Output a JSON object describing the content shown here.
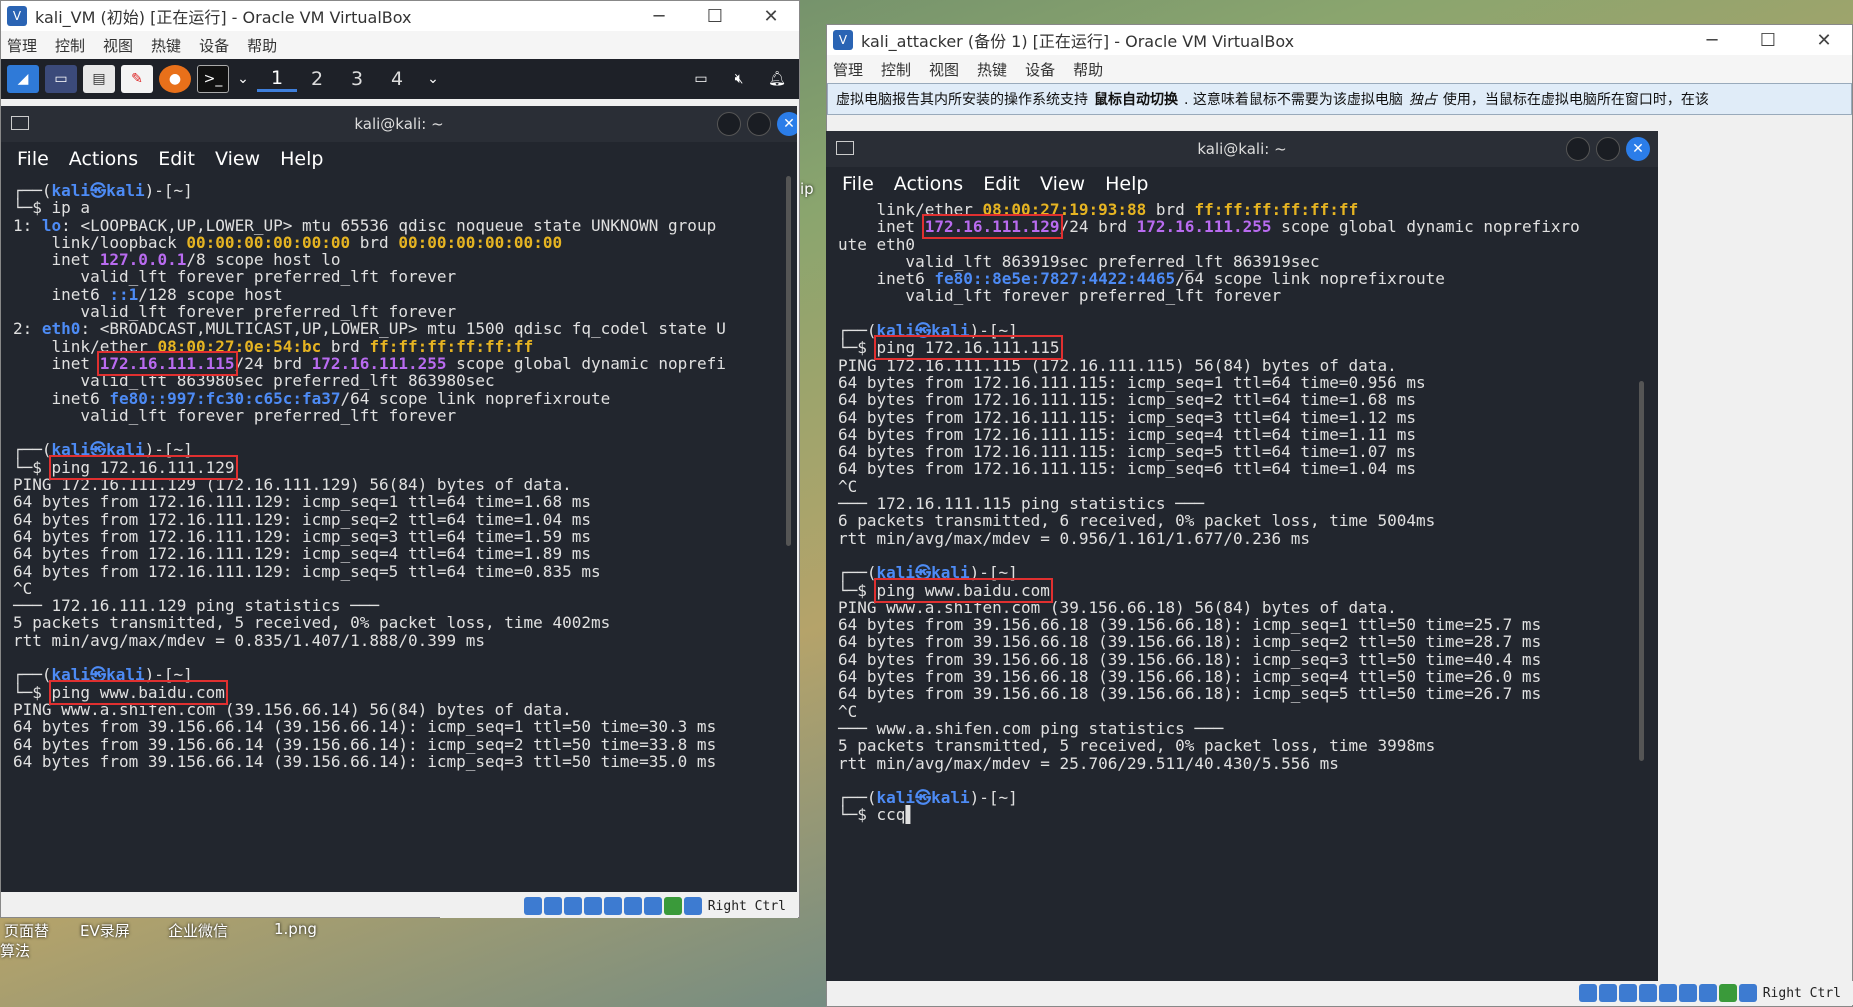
{
  "desktop": {
    "labels": [
      "页面替",
      "EV录屏",
      "企业微信",
      "1.png",
      "算法"
    ],
    "side_label": "ip"
  },
  "left": {
    "title": "kali_VM (初始) [正在运行] - Oracle VM VirtualBox",
    "menu": [
      "管理",
      "控制",
      "视图",
      "热键",
      "设备",
      "帮助"
    ],
    "workspaces": [
      "1",
      "2",
      "3",
      "4"
    ],
    "term_title": "kali@kali: ~",
    "term_menu": [
      "File",
      "Actions",
      "Edit",
      "View",
      "Help"
    ],
    "status": "Right Ctrl",
    "lines": [
      [
        {
          "t": "┌──(",
          "c": ""
        },
        {
          "t": "kali㉿kali",
          "c": "blue"
        },
        {
          "t": ")-[~]",
          "c": ""
        }
      ],
      [
        {
          "t": "└─$ ",
          "c": ""
        },
        {
          "t": "ip a",
          "c": ""
        }
      ],
      [
        {
          "t": "1: ",
          "c": ""
        },
        {
          "t": "lo",
          "c": "blue"
        },
        {
          "t": ": <LOOPBACK,UP,LOWER_UP> mtu 65536 qdisc noqueue state UNKNOWN group",
          "c": ""
        }
      ],
      [
        {
          "t": "    link/loopback ",
          "c": ""
        },
        {
          "t": "00:00:00:00:00:00",
          "c": "yel"
        },
        {
          "t": " brd ",
          "c": ""
        },
        {
          "t": "00:00:00:00:00:00",
          "c": "yel"
        }
      ],
      [
        {
          "t": "    inet ",
          "c": ""
        },
        {
          "t": "127.0.0.1",
          "c": "purp"
        },
        {
          "t": "/8 scope host lo",
          "c": ""
        }
      ],
      [
        {
          "t": "       valid_lft forever preferred_lft forever",
          "c": ""
        }
      ],
      [
        {
          "t": "    inet6 ",
          "c": ""
        },
        {
          "t": "::1",
          "c": "blue"
        },
        {
          "t": "/128 scope host",
          "c": ""
        }
      ],
      [
        {
          "t": "       valid_lft forever preferred_lft forever",
          "c": ""
        }
      ],
      [
        {
          "t": "2: ",
          "c": ""
        },
        {
          "t": "eth0",
          "c": "blue"
        },
        {
          "t": ": <BROADCAST,MULTICAST,UP,LOWER_UP> mtu 1500 qdisc fq_codel state U",
          "c": ""
        }
      ],
      [
        {
          "t": "    link/ether ",
          "c": ""
        },
        {
          "t": "08:00:27:0e:54:bc",
          "c": "yel"
        },
        {
          "t": " brd ",
          "c": ""
        },
        {
          "t": "ff:ff:ff:ff:ff:ff",
          "c": "yel"
        }
      ],
      [
        {
          "t": "    inet ",
          "c": ""
        },
        {
          "t": "172.16.111.115",
          "c": "purp",
          "hl": true
        },
        {
          "t": "/24 brd ",
          "c": ""
        },
        {
          "t": "172.16.111.255",
          "c": "purp"
        },
        {
          "t": " scope global dynamic noprefi",
          "c": ""
        }
      ],
      [
        {
          "t": "       valid_lft 863980sec preferred_lft 863980sec",
          "c": ""
        }
      ],
      [
        {
          "t": "    inet6 ",
          "c": ""
        },
        {
          "t": "fe80::997:fc30:c65c:fa37",
          "c": "blue"
        },
        {
          "t": "/64 scope link noprefixroute",
          "c": ""
        }
      ],
      [
        {
          "t": "       valid_lft forever preferred_lft forever",
          "c": ""
        }
      ],
      [
        {
          "t": "",
          "c": ""
        }
      ],
      [
        {
          "t": "┌──(",
          "c": ""
        },
        {
          "t": "kali㉿kali",
          "c": "blue"
        },
        {
          "t": ")-[~]",
          "c": ""
        }
      ],
      [
        {
          "t": "└─$ ",
          "c": ""
        },
        {
          "t": "ping 172.16.111.129",
          "c": "",
          "hl": true
        }
      ],
      [
        {
          "t": "PING 172.16.111.129 (172.16.111.129) 56(84) bytes of data.",
          "c": ""
        }
      ],
      [
        {
          "t": "64 bytes from 172.16.111.129: icmp_seq=1 ttl=64 time=1.68 ms",
          "c": ""
        }
      ],
      [
        {
          "t": "64 bytes from 172.16.111.129: icmp_seq=2 ttl=64 time=1.04 ms",
          "c": ""
        }
      ],
      [
        {
          "t": "64 bytes from 172.16.111.129: icmp_seq=3 ttl=64 time=1.59 ms",
          "c": ""
        }
      ],
      [
        {
          "t": "64 bytes from 172.16.111.129: icmp_seq=4 ttl=64 time=1.89 ms",
          "c": ""
        }
      ],
      [
        {
          "t": "64 bytes from 172.16.111.129: icmp_seq=5 ttl=64 time=0.835 ms",
          "c": ""
        }
      ],
      [
        {
          "t": "^C",
          "c": ""
        }
      ],
      [
        {
          "t": "─── 172.16.111.129 ping statistics ───",
          "c": ""
        }
      ],
      [
        {
          "t": "5 packets transmitted, 5 received, 0% packet loss, time 4002ms",
          "c": ""
        }
      ],
      [
        {
          "t": "rtt min/avg/max/mdev = 0.835/1.407/1.888/0.399 ms",
          "c": ""
        }
      ],
      [
        {
          "t": "",
          "c": ""
        }
      ],
      [
        {
          "t": "┌──(",
          "c": ""
        },
        {
          "t": "kali㉿kali",
          "c": "blue"
        },
        {
          "t": ")-[~]",
          "c": ""
        }
      ],
      [
        {
          "t": "└─$ ",
          "c": ""
        },
        {
          "t": "ping www.baidu.com",
          "c": "",
          "hl": true
        }
      ],
      [
        {
          "t": "PING www.a.shifen.com (39.156.66.14) 56(84) bytes of data.",
          "c": ""
        }
      ],
      [
        {
          "t": "64 bytes from 39.156.66.14 (39.156.66.14): icmp_seq=1 ttl=50 time=30.3 ms",
          "c": ""
        }
      ],
      [
        {
          "t": "64 bytes from 39.156.66.14 (39.156.66.14): icmp_seq=2 ttl=50 time=33.8 ms",
          "c": ""
        }
      ],
      [
        {
          "t": "64 bytes from 39.156.66.14 (39.156.66.14): icmp_seq=3 ttl=50 time=35.0 ms",
          "c": ""
        }
      ]
    ]
  },
  "right": {
    "title": "kali_attacker (备份 1) [正在运行] - Oracle VM VirtualBox",
    "menu": [
      "管理",
      "控制",
      "视图",
      "热键",
      "设备",
      "帮助"
    ],
    "info_pre": "虚拟电脑报告其内所安装的操作系统支持",
    "info_bold": "鼠标自动切换",
    "info_post": ". 这意味着鼠标不需要为该虚拟电脑",
    "info_italic": "独占",
    "info_tail": "使用，当鼠标在虚拟电脑所在窗口时，在该",
    "term_title": "kali@kali: ~",
    "term_menu": [
      "File",
      "Actions",
      "Edit",
      "View",
      "Help"
    ],
    "status": "Right Ctrl",
    "lines": [
      [
        {
          "t": "    link/ether ",
          "c": ""
        },
        {
          "t": "08:00:27:19:93:88",
          "c": "yel"
        },
        {
          "t": " brd ",
          "c": ""
        },
        {
          "t": "ff:ff:ff:ff:ff:ff",
          "c": "yel"
        }
      ],
      [
        {
          "t": "    inet ",
          "c": ""
        },
        {
          "t": "172.16.111.129",
          "c": "purp",
          "hl": true
        },
        {
          "t": "/24 brd ",
          "c": ""
        },
        {
          "t": "172.16.111.255",
          "c": "purp"
        },
        {
          "t": " scope global dynamic noprefixro",
          "c": ""
        }
      ],
      [
        {
          "t": "ute eth0",
          "c": ""
        }
      ],
      [
        {
          "t": "       valid_lft 863919sec preferred_lft 863919sec",
          "c": ""
        }
      ],
      [
        {
          "t": "    inet6 ",
          "c": ""
        },
        {
          "t": "fe80::8e5e:7827:4422:4465",
          "c": "blue"
        },
        {
          "t": "/64 scope link noprefixroute",
          "c": ""
        }
      ],
      [
        {
          "t": "       valid_lft forever preferred_lft forever",
          "c": ""
        }
      ],
      [
        {
          "t": "",
          "c": ""
        }
      ],
      [
        {
          "t": "┌──(",
          "c": ""
        },
        {
          "t": "kali㉿kali",
          "c": "blue"
        },
        {
          "t": ")-[~]",
          "c": ""
        }
      ],
      [
        {
          "t": "└─$ ",
          "c": ""
        },
        {
          "t": "ping 172.16.111.115",
          "c": "",
          "hl": true
        }
      ],
      [
        {
          "t": "PING 172.16.111.115 (172.16.111.115) 56(84) bytes of data.",
          "c": ""
        }
      ],
      [
        {
          "t": "64 bytes from 172.16.111.115: icmp_seq=1 ttl=64 time=0.956 ms",
          "c": ""
        }
      ],
      [
        {
          "t": "64 bytes from 172.16.111.115: icmp_seq=2 ttl=64 time=1.68 ms",
          "c": ""
        }
      ],
      [
        {
          "t": "64 bytes from 172.16.111.115: icmp_seq=3 ttl=64 time=1.12 ms",
          "c": ""
        }
      ],
      [
        {
          "t": "64 bytes from 172.16.111.115: icmp_seq=4 ttl=64 time=1.11 ms",
          "c": ""
        }
      ],
      [
        {
          "t": "64 bytes from 172.16.111.115: icmp_seq=5 ttl=64 time=1.07 ms",
          "c": ""
        }
      ],
      [
        {
          "t": "64 bytes from 172.16.111.115: icmp_seq=6 ttl=64 time=1.04 ms",
          "c": ""
        }
      ],
      [
        {
          "t": "^C",
          "c": ""
        }
      ],
      [
        {
          "t": "─── 172.16.111.115 ping statistics ───",
          "c": ""
        }
      ],
      [
        {
          "t": "6 packets transmitted, 6 received, 0% packet loss, time 5004ms",
          "c": ""
        }
      ],
      [
        {
          "t": "rtt min/avg/max/mdev = 0.956/1.161/1.677/0.236 ms",
          "c": ""
        }
      ],
      [
        {
          "t": "",
          "c": ""
        }
      ],
      [
        {
          "t": "┌──(",
          "c": ""
        },
        {
          "t": "kali㉿kali",
          "c": "blue"
        },
        {
          "t": ")-[~]",
          "c": ""
        }
      ],
      [
        {
          "t": "└─$ ",
          "c": ""
        },
        {
          "t": "ping www.baidu.com",
          "c": "",
          "hl": true
        }
      ],
      [
        {
          "t": "PING www.a.shifen.com (39.156.66.18) 56(84) bytes of data.",
          "c": ""
        }
      ],
      [
        {
          "t": "64 bytes from 39.156.66.18 (39.156.66.18): icmp_seq=1 ttl=50 time=25.7 ms",
          "c": ""
        }
      ],
      [
        {
          "t": "64 bytes from 39.156.66.18 (39.156.66.18): icmp_seq=2 ttl=50 time=28.7 ms",
          "c": ""
        }
      ],
      [
        {
          "t": "64 bytes from 39.156.66.18 (39.156.66.18): icmp_seq=3 ttl=50 time=40.4 ms",
          "c": ""
        }
      ],
      [
        {
          "t": "64 bytes from 39.156.66.18 (39.156.66.18): icmp_seq=4 ttl=50 time=26.0 ms",
          "c": ""
        }
      ],
      [
        {
          "t": "64 bytes from 39.156.66.18 (39.156.66.18): icmp_seq=5 ttl=50 time=26.7 ms",
          "c": ""
        }
      ],
      [
        {
          "t": "^C",
          "c": ""
        }
      ],
      [
        {
          "t": "─── www.a.shifen.com ping statistics ───",
          "c": ""
        }
      ],
      [
        {
          "t": "5 packets transmitted, 5 received, 0% packet loss, time 3998ms",
          "c": ""
        }
      ],
      [
        {
          "t": "rtt min/avg/max/mdev = 25.706/29.511/40.430/5.556 ms",
          "c": ""
        }
      ],
      [
        {
          "t": "",
          "c": ""
        }
      ],
      [
        {
          "t": "┌──(",
          "c": ""
        },
        {
          "t": "kali㉿kali",
          "c": "blue"
        },
        {
          "t": ")-[~]",
          "c": ""
        }
      ],
      [
        {
          "t": "└─$ ",
          "c": ""
        },
        {
          "t": "ccq",
          "c": ""
        },
        {
          "t": "▌",
          "c": ""
        }
      ]
    ]
  }
}
